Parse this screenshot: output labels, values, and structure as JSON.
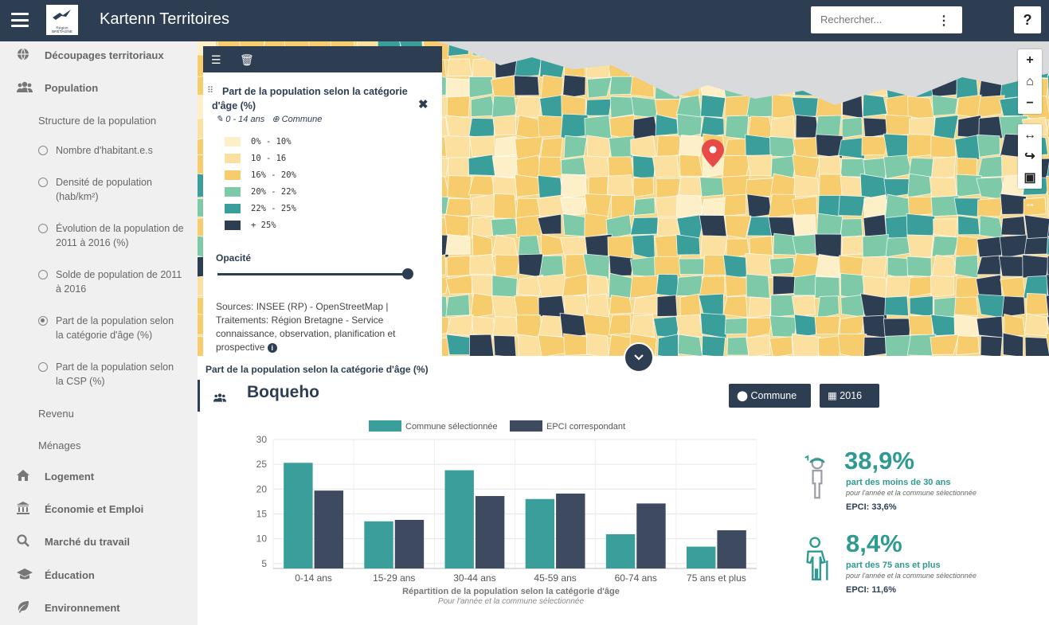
{
  "header": {
    "app_title": "Kartenn Territoires",
    "logo_text": "Région BRETAGNE",
    "search_placeholder": "Rechercher...",
    "help_label": "?"
  },
  "sidebar": {
    "items": [
      {
        "label": "Découpages territoriaux",
        "icon": "globe-icon"
      },
      {
        "label": "Population",
        "icon": "users-icon"
      },
      {
        "label": "Logement",
        "icon": "home-icon"
      },
      {
        "label": "Économie et Emploi",
        "icon": "bank-icon"
      },
      {
        "label": "Marché du travail",
        "icon": "search-icon"
      },
      {
        "label": "Éducation",
        "icon": "graduation-cap-icon"
      },
      {
        "label": "Environnement",
        "icon": "leaf-icon"
      }
    ],
    "population_sub": {
      "section": "Structure de la population",
      "options": [
        {
          "label": "Nombre d'habitant.e.s",
          "checked": false
        },
        {
          "label": "Densité de population (hab/km²)",
          "checked": false
        },
        {
          "label": "Évolution de la population de 2011 à 2016 (%)",
          "checked": false
        },
        {
          "label": "Solde de population de 2011 à 2016",
          "checked": false
        },
        {
          "label": "Part de la population selon la catégorie d'âge (%)",
          "checked": true
        },
        {
          "label": "Part de la population selon la CSP (%)",
          "checked": false
        }
      ],
      "others": [
        "Revenu",
        "Ménages"
      ]
    }
  },
  "legend": {
    "title": "Part de la population selon la catégorie d'âge (%)",
    "filter": "0 - 14 ans",
    "level": "Commune",
    "classes": [
      {
        "label": "0% - 10%",
        "color": "#fdf0c8"
      },
      {
        "label": "10 - 16",
        "color": "#fbe0a0"
      },
      {
        "label": "16% - 20%",
        "color": "#f7cc6c"
      },
      {
        "label": "20% - 22%",
        "color": "#7ecaa8"
      },
      {
        "label": "22% - 25%",
        "color": "#3a9e9a"
      },
      {
        "label": "+ 25%",
        "color": "#2d3e53"
      }
    ],
    "opacity_label": "Opacité",
    "opacity_value": 1.0,
    "sources": "Sources: INSEE (RP) - OpenStreetMap | Traitements: Région Bretagne - Service connaissance, observation, planification et prospective"
  },
  "map_controls": [
    "+",
    "⌂",
    "−",
    "↔",
    "↪",
    "▣"
  ],
  "panel": {
    "caption": "Part de la population selon la catégorie d'âge (%)",
    "commune_name": "Boqueho",
    "level_button": "Commune",
    "year_button": "2016"
  },
  "chart_data": {
    "type": "bar",
    "categories": [
      "0-14 ans",
      "15-29 ans",
      "30-44 ans",
      "45-59 ans",
      "60-74 ans",
      "75 ans et plus"
    ],
    "series": [
      {
        "name": "Commune sélectionnée",
        "color": "#3a9e9a",
        "values": [
          25.3,
          13.5,
          23.8,
          18.0,
          10.9,
          8.4
        ]
      },
      {
        "name": "EPCI correspondant",
        "color": "#3e4a5f",
        "values": [
          19.7,
          13.8,
          18.6,
          19.1,
          17.1,
          11.7
        ]
      }
    ],
    "yticks": [
      5,
      10,
      15,
      20,
      25,
      30
    ],
    "ylim": [
      4,
      30
    ],
    "xlabel": "Répartition de la population selon la catégorie d'âge",
    "subtitle": "Pour l'année et la commune sélectionnée",
    "legend_position": "top"
  },
  "stats": [
    {
      "value": "38,9%",
      "label": "part des moins de 30 ans",
      "note": "pour l'année et la commune sélectionnée",
      "epci": "EPCI: 33,6%"
    },
    {
      "value": "8,4%",
      "label": "part des 75 ans et plus",
      "note": "pour l'année et la commune sélectionnée",
      "epci": "EPCI: 11,6%"
    }
  ]
}
